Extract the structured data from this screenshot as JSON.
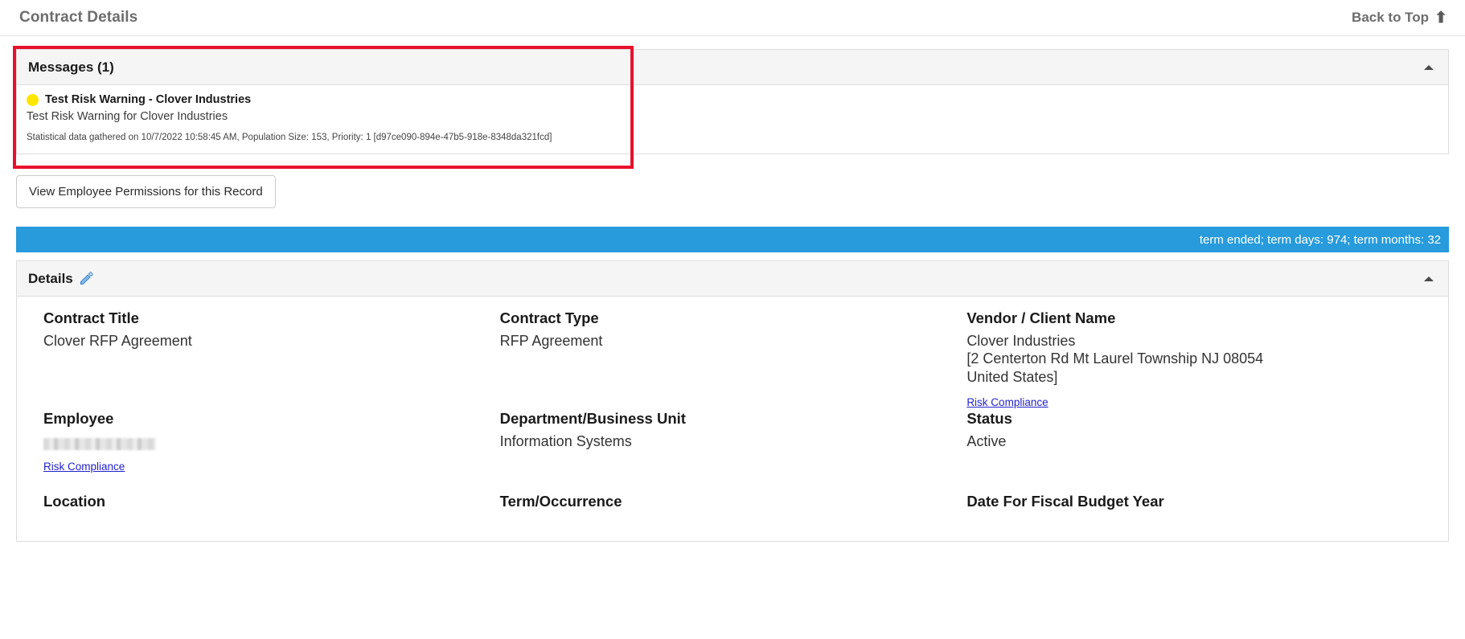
{
  "header": {
    "title": "Contract Details",
    "back_to_top": "Back to Top",
    "back_to_top_icon": "arrow-up-icon"
  },
  "messages_panel": {
    "title": "Messages (1)",
    "collapse_icon": "caret-up-icon",
    "highlight_color": "#e8112d",
    "message": {
      "severity_icon": "yellow-status-dot-icon",
      "severity_color": "#ffe600",
      "title": "Test Risk Warning - Clover Industries",
      "subtitle": "Test Risk Warning for Clover Industries",
      "meta": "Statistical data gathered on 10/7/2022 10:58:45 AM, Population Size: 153, Priority: 1 [d97ce090-894e-47b5-918e-8348da321fcd]"
    }
  },
  "permissions": {
    "button_label": "View Employee Permissions for this Record"
  },
  "term_bar": {
    "text": "term ended; term days: 974; term months: 32",
    "background_color": "#279bdb"
  },
  "details_panel": {
    "title": "Details",
    "edit_icon": "pencil-edit-icon",
    "collapse_icon": "caret-up-icon",
    "rows": [
      {
        "fields": [
          {
            "label": "Contract Title",
            "value": "Clover RFP Agreement",
            "link": null,
            "redacted": false
          },
          {
            "label": "Contract Type",
            "value": "RFP Agreement",
            "link": null,
            "redacted": false
          },
          {
            "label": "Vendor / Client Name",
            "value": "Clover Industries\n[2 Centerton Rd Mt Laurel Township NJ 08054\nUnited States]",
            "link": "Risk Compliance",
            "redacted": false
          }
        ]
      },
      {
        "fields": [
          {
            "label": "Employee",
            "value": "",
            "link": "Risk Compliance",
            "redacted": true
          },
          {
            "label": "Department/Business Unit",
            "value": "Information Systems",
            "link": null,
            "redacted": false
          },
          {
            "label": "Status",
            "value": "Active",
            "link": null,
            "redacted": false
          }
        ]
      },
      {
        "fields": [
          {
            "label": "Location",
            "value": "",
            "link": null,
            "redacted": false
          },
          {
            "label": "Term/Occurrence",
            "value": "",
            "link": null,
            "redacted": false
          },
          {
            "label": "Date For Fiscal Budget Year",
            "value": "",
            "link": null,
            "redacted": false
          }
        ]
      }
    ]
  }
}
